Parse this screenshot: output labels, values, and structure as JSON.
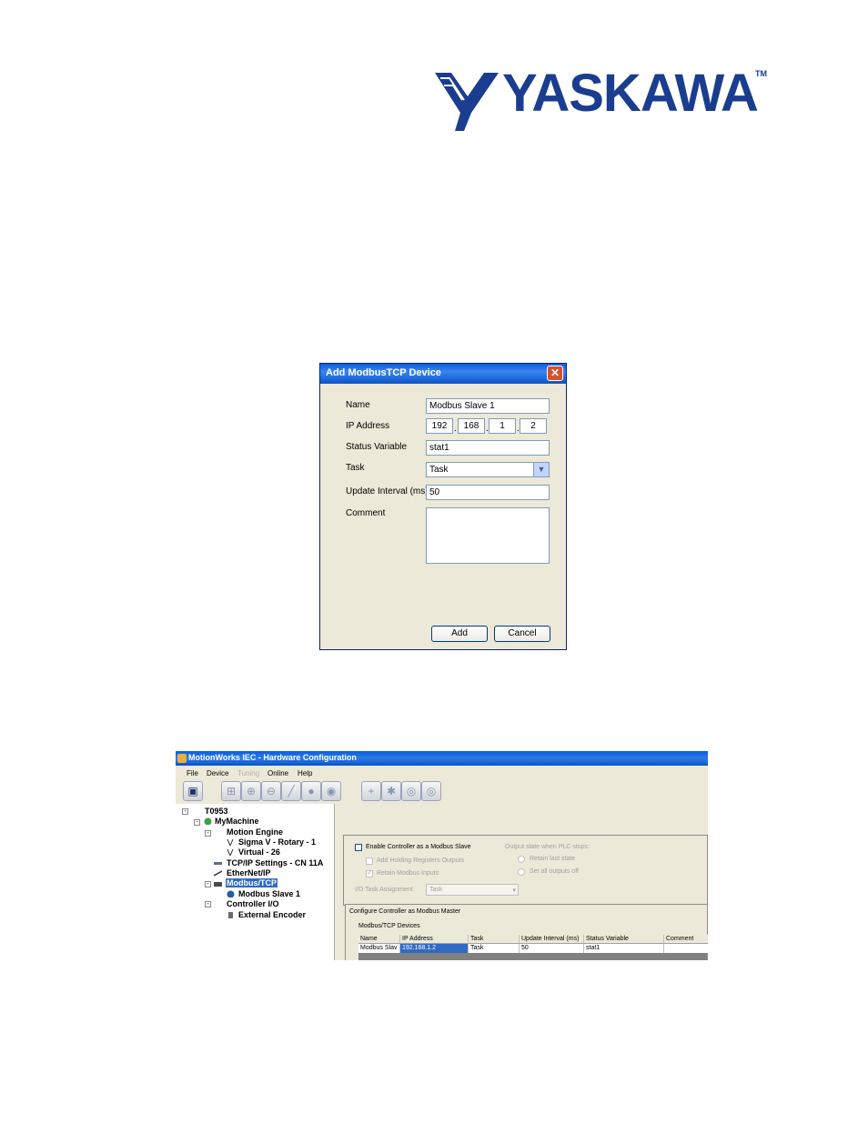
{
  "logo": {
    "text": "YASKAWA",
    "tm": "TM"
  },
  "dialog": {
    "title": "Add ModbusTCP Device",
    "close_glyph": "✕",
    "fields": {
      "name_label": "Name",
      "name_value": "Modbus Slave 1",
      "ip_label": "IP Address",
      "ip": [
        "192",
        "168",
        "1",
        "2"
      ],
      "status_label": "Status Variable",
      "status_value": "stat1",
      "task_label": "Task",
      "task_value": "Task",
      "interval_label": "Update Interval (ms)",
      "interval_value": "50",
      "comment_label": "Comment",
      "comment_value": ""
    },
    "buttons": {
      "add": "Add",
      "cancel": "Cancel"
    }
  },
  "window": {
    "title": "MotionWorks IEC - Hardware Configuration",
    "menu": [
      "File",
      "Device",
      "Tuning",
      "Online",
      "Help"
    ],
    "tree": {
      "root": "T0953",
      "machine": "MyMachine",
      "motion_engine": "Motion Engine",
      "axis1": "Sigma V - Rotary - 1",
      "axis2": "Virtual - 26",
      "tcpip": "TCP/IP Settings - CN 11A",
      "ethernetip": "EtherNet/IP",
      "modbus": "Modbus/TCP",
      "modbus_slave": "Modbus Slave 1",
      "controller_io": "Controller I/O",
      "encoder": "External Encoder"
    },
    "slave_group": {
      "enable": "Enable Controller as a Modbus Slave",
      "holding": "Add Holding Registers Outputs",
      "retain": "Retain Modbus Inputs",
      "output_state": "Output state when PLC stops:",
      "retain_last": "Retain last state",
      "set_off": "Set all outputs off",
      "io_task_label": "I/O Task Assignment",
      "io_task_value": "Task"
    },
    "master_group": {
      "title": "Configure Controller as Modbus Master",
      "devices_label": "Modbus/TCP Devices",
      "columns": [
        "Name",
        "IP Address",
        "Task",
        "Update Interval (ms)",
        "Status Variable",
        "Comment"
      ],
      "row": [
        "Modbus Slav",
        "192.168.1.2",
        "Task",
        "50",
        "stat1",
        ""
      ]
    }
  }
}
